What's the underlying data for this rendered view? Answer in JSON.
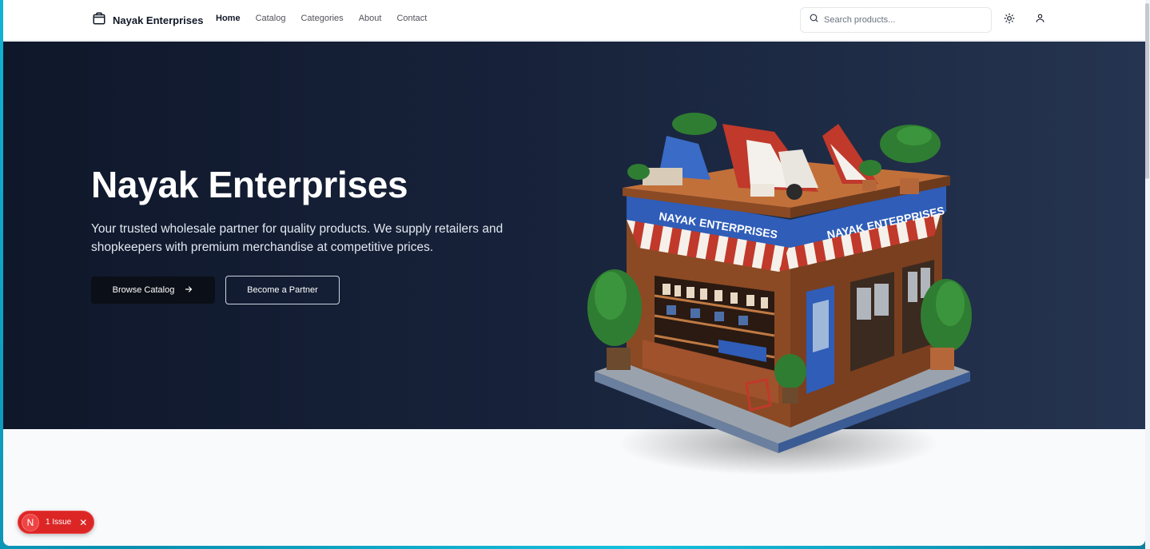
{
  "brand": {
    "name": "Nayak Enterprises",
    "icon": "shopping-bag-icon"
  },
  "nav": {
    "items": [
      {
        "label": "Home",
        "active": true
      },
      {
        "label": "Catalog",
        "active": false
      },
      {
        "label": "Categories",
        "active": false
      },
      {
        "label": "About",
        "active": false
      },
      {
        "label": "Contact",
        "active": false
      }
    ]
  },
  "search": {
    "placeholder": "Search products...",
    "value": ""
  },
  "hero": {
    "title": "Nayak Enterprises",
    "subtitle": "Your trusted wholesale partner for quality products. We supply retailers and shopkeepers with premium merchandise at competitive prices.",
    "primary_button": "Browse Catalog",
    "secondary_button": "Become a Partner",
    "store_sign_left": "NAYAK ENTERPRISES",
    "store_sign_right": "NAYAK ENTERPRISES"
  },
  "issue_badge": {
    "icon_letter": "N",
    "label": "1 Issue"
  },
  "colors": {
    "hero_dark": "#0f172a",
    "hero_light": "#253450",
    "issue_red": "#dc2626",
    "awning_red": "#c0392b",
    "sign_blue": "#2f5db8"
  }
}
